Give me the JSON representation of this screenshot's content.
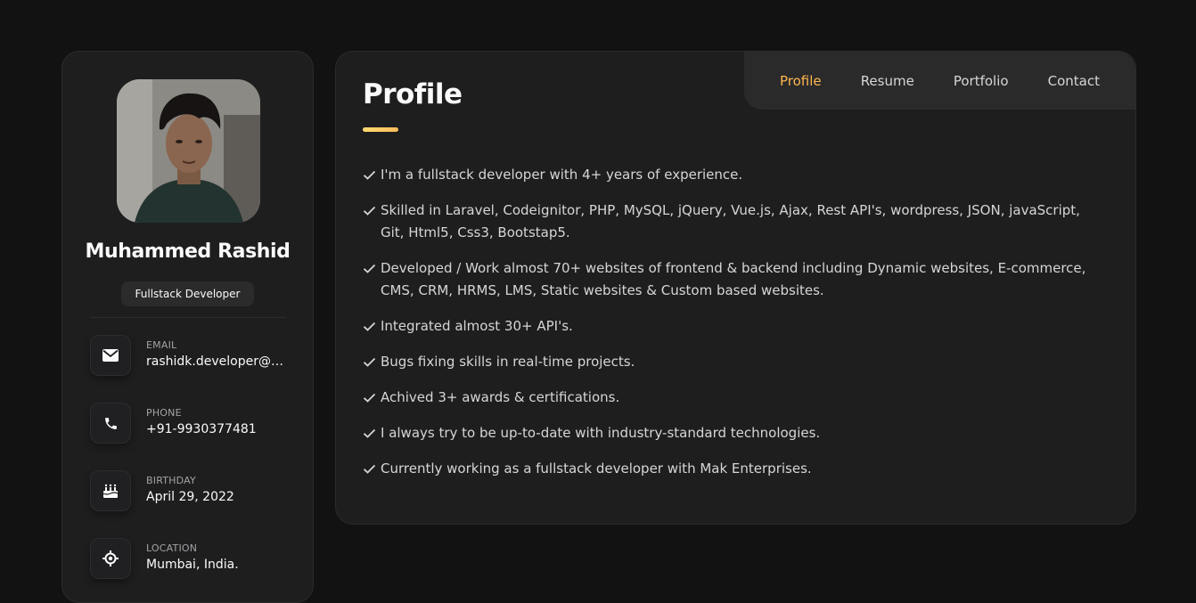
{
  "sidebar": {
    "name": "Muhammed Rashid",
    "title": "Fullstack Developer",
    "contacts": [
      {
        "label": "EMAIL",
        "value": "rashidk.developer@g...",
        "icon": "mail-icon"
      },
      {
        "label": "PHONE",
        "value": "+91-9930377481",
        "icon": "phone-icon"
      },
      {
        "label": "BIRTHDAY",
        "value": "April 29, 2022",
        "icon": "cake-icon"
      },
      {
        "label": "LOCATION",
        "value": "Mumbai, India.",
        "icon": "location-icon"
      }
    ]
  },
  "nav": {
    "items": [
      "Profile",
      "Resume",
      "Portfolio",
      "Contact"
    ],
    "active": "Profile"
  },
  "main": {
    "title": "Profile",
    "bullets": [
      "I'm a fullstack developer with 4+ years of experience.",
      "Skilled in Laravel, Codeignitor, PHP, MySQL, jQuery, Vue.js, Ajax, Rest API's, wordpress, JSON, javaScript, Git, Html5, Css3, Bootstap5.",
      "Developed / Work almost 70+ websites of frontend & backend including Dynamic websites, E-commerce, CMS, CRM, HRMS, LMS, Static websites & Custom based websites.",
      "Integrated almost 30+ API's.",
      "Bugs fixing skills in real-time projects.",
      "Achived 3+ awards & certifications.",
      "I always try to be up-to-date with industry-standard technologies.",
      "Currently working as a fullstack developer with Mak Enterprises."
    ]
  },
  "colors": {
    "accent": "#ffb64f",
    "background": "#121212",
    "card": "#1e1e1f"
  }
}
